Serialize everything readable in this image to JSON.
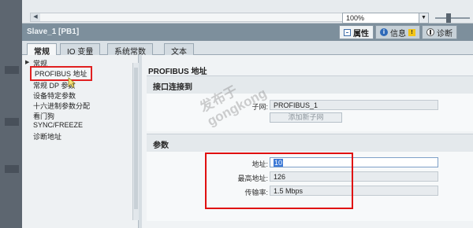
{
  "toolbar": {
    "zoom_value": "100%"
  },
  "inspector": {
    "title": "Slave_1 [PB1]",
    "tabs": [
      {
        "label": "属性",
        "icon": "properties-icon"
      },
      {
        "label": "信息",
        "icon": "info-icon"
      },
      {
        "label": "诊断",
        "icon": "diagnostics-icon"
      }
    ]
  },
  "main_tabs": [
    "常规",
    "IO 变量",
    "系统常数",
    "文本"
  ],
  "nav": {
    "items": [
      "常规",
      "PROFIBUS 地址",
      "常规 DP 参数",
      "设备特定参数",
      "十六进制参数分配",
      "看门狗",
      "SYNC/FREEZE",
      "诊断地址"
    ],
    "selected_index": 1
  },
  "content": {
    "heading": "PROFIBUS 地址",
    "interface": {
      "title": "接口连接到",
      "subnet_label": "子网:",
      "subnet_value": "PROFIBUS_1",
      "add_subnet_button": "添加新子网"
    },
    "params": {
      "title": "参数",
      "address_label": "地址:",
      "address_value": "10",
      "max_address_label": "最高地址:",
      "max_address_value": "126",
      "baud_label": "传输率:",
      "baud_value": "1.5 Mbps"
    }
  },
  "watermark": {
    "line1": "发布于",
    "line2": "gongkong"
  }
}
